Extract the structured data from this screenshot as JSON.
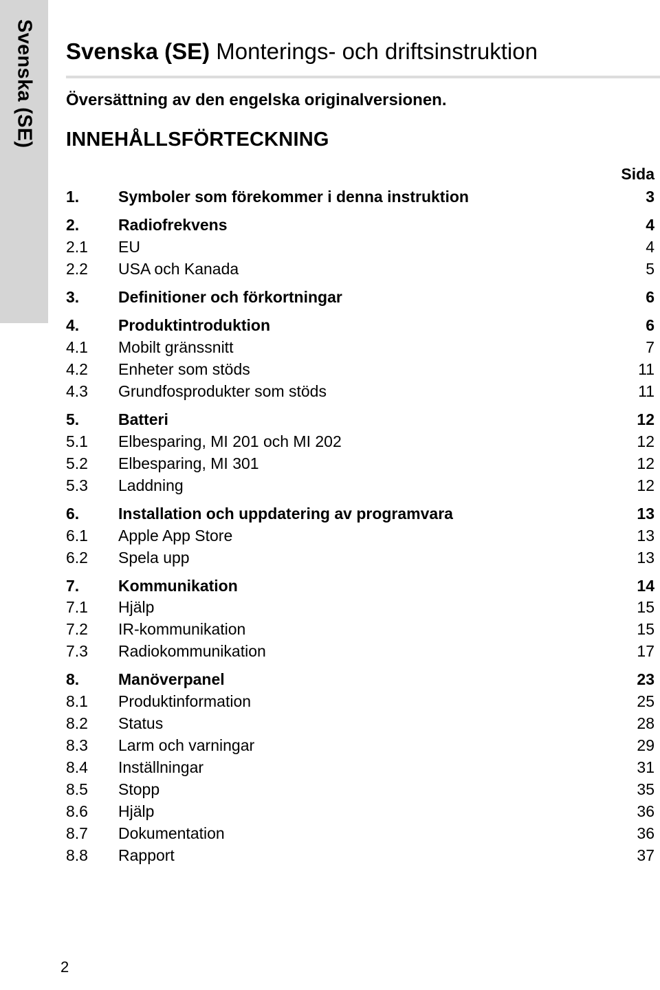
{
  "language_tab": {
    "label": "Svenska (SE)"
  },
  "header": {
    "title_strong": "Svenska (SE)",
    "title_rest": " Monterings- och driftsinstruktion",
    "subtitle": "Översättning av den engelska originalversionen.",
    "toc_heading": "INNEHÅLLSFÖRTECKNING"
  },
  "toc": {
    "page_column_header": "Sida",
    "entries": [
      {
        "number": "1.",
        "label": "Symboler som förekommer i denna instruktion",
        "page": "3",
        "level": 1
      },
      {
        "number": "2.",
        "label": "Radiofrekvens",
        "page": "4",
        "level": 1
      },
      {
        "number": "2.1",
        "label": "EU",
        "page": "4",
        "level": 2
      },
      {
        "number": "2.2",
        "label": "USA och Kanada",
        "page": "5",
        "level": 2
      },
      {
        "number": "3.",
        "label": "Definitioner och förkortningar",
        "page": "6",
        "level": 1
      },
      {
        "number": "4.",
        "label": "Produktintroduktion",
        "page": "6",
        "level": 1
      },
      {
        "number": "4.1",
        "label": "Mobilt gränssnitt",
        "page": "7",
        "level": 2
      },
      {
        "number": "4.2",
        "label": "Enheter som stöds",
        "page": "11",
        "level": 2
      },
      {
        "number": "4.3",
        "label": "Grundfosprodukter som stöds",
        "page": "11",
        "level": 2
      },
      {
        "number": "5.",
        "label": "Batteri",
        "page": "12",
        "level": 1
      },
      {
        "number": "5.1",
        "label": "Elbesparing, MI 201 och MI 202",
        "page": "12",
        "level": 2
      },
      {
        "number": "5.2",
        "label": "Elbesparing, MI 301",
        "page": "12",
        "level": 2
      },
      {
        "number": "5.3",
        "label": "Laddning",
        "page": "12",
        "level": 2
      },
      {
        "number": "6.",
        "label": "Installation och uppdatering av programvara",
        "page": "13",
        "level": 1
      },
      {
        "number": "6.1",
        "label": "Apple App Store",
        "page": "13",
        "level": 2
      },
      {
        "number": "6.2",
        "label": "Spela upp",
        "page": "13",
        "level": 2
      },
      {
        "number": "7.",
        "label": "Kommunikation",
        "page": "14",
        "level": 1
      },
      {
        "number": "7.1",
        "label": "Hjälp",
        "page": "15",
        "level": 2
      },
      {
        "number": "7.2",
        "label": "IR-kommunikation",
        "page": "15",
        "level": 2
      },
      {
        "number": "7.3",
        "label": "Radiokommunikation",
        "page": "17",
        "level": 2
      },
      {
        "number": "8.",
        "label": "Manöverpanel",
        "page": "23",
        "level": 1
      },
      {
        "number": "8.1",
        "label": "Produktinformation",
        "page": "25",
        "level": 2
      },
      {
        "number": "8.2",
        "label": "Status",
        "page": "28",
        "level": 2
      },
      {
        "number": "8.3",
        "label": "Larm och varningar",
        "page": "29",
        "level": 2
      },
      {
        "number": "8.4",
        "label": "Inställningar",
        "page": "31",
        "level": 2
      },
      {
        "number": "8.5",
        "label": "Stopp",
        "page": "35",
        "level": 2
      },
      {
        "number": "8.6",
        "label": "Hjälp",
        "page": "36",
        "level": 2
      },
      {
        "number": "8.7",
        "label": "Dokumentation",
        "page": "36",
        "level": 2
      },
      {
        "number": "8.8",
        "label": "Rapport",
        "page": "37",
        "level": 2
      }
    ]
  },
  "footer": {
    "page_number": "2"
  },
  "colors": {
    "tab_background": "#d5d5d5",
    "rule": "#dddddd",
    "text": "#000000",
    "page_background": "#ffffff"
  }
}
